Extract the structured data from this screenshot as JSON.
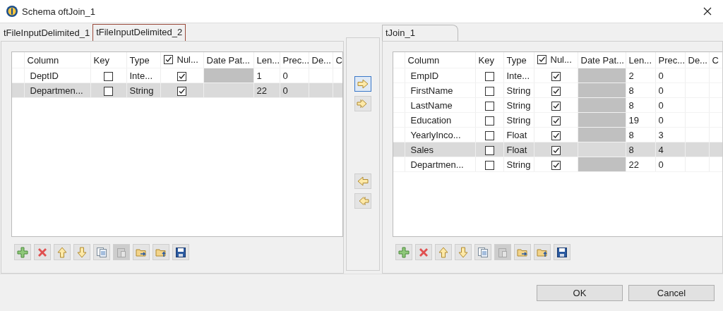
{
  "window": {
    "title": "Schema oftJoin_1"
  },
  "panels": [
    {
      "tabs": [
        {
          "label": "tFileInputDelimited_1",
          "selected": false
        },
        {
          "label": "tFileInputDelimited_2",
          "selected": true
        }
      ],
      "table": {
        "columns": [
          "Column",
          "Key",
          "Type",
          "Nul...",
          "Date Pat...",
          "Len...",
          "Prec...",
          "De...",
          "C"
        ],
        "nullable_header_checked": true,
        "rows": [
          {
            "name": "DeptID",
            "key": false,
            "type": "Inte...",
            "nullable": true,
            "length": "1",
            "precision": "0",
            "selected": false
          },
          {
            "name": "Departmen...",
            "key": false,
            "type": "String",
            "nullable": true,
            "length": "22",
            "precision": "0",
            "selected": true
          }
        ]
      },
      "toolbar": [
        {
          "kind": "add",
          "disabled": false
        },
        {
          "kind": "delete",
          "disabled": false
        },
        {
          "kind": "up",
          "disabled": false
        },
        {
          "kind": "down",
          "disabled": false
        },
        {
          "kind": "copy",
          "disabled": false
        },
        {
          "kind": "paste",
          "disabled": true
        },
        {
          "kind": "import",
          "disabled": false
        },
        {
          "kind": "export",
          "disabled": false
        },
        {
          "kind": "save",
          "disabled": false
        }
      ]
    },
    {
      "tabs": [
        {
          "label": "tJoin_1",
          "selected": false
        }
      ],
      "table": {
        "columns": [
          "Column",
          "Key",
          "Type",
          "Nul...",
          "Date Pat...",
          "Len...",
          "Prec...",
          "De...",
          "C"
        ],
        "nullable_header_checked": true,
        "rows": [
          {
            "name": "EmpID",
            "key": false,
            "type": "Inte...",
            "nullable": true,
            "length": "2",
            "precision": "0",
            "selected": false
          },
          {
            "name": "FirstName",
            "key": false,
            "type": "String",
            "nullable": true,
            "length": "8",
            "precision": "0",
            "selected": false
          },
          {
            "name": "LastName",
            "key": false,
            "type": "String",
            "nullable": true,
            "length": "8",
            "precision": "0",
            "selected": false
          },
          {
            "name": "Education",
            "key": false,
            "type": "String",
            "nullable": true,
            "length": "19",
            "precision": "0",
            "selected": false
          },
          {
            "name": "YearlyInco...",
            "key": false,
            "type": "Float",
            "nullable": true,
            "length": "8",
            "precision": "3",
            "selected": false
          },
          {
            "name": "Sales",
            "key": false,
            "type": "Float",
            "nullable": true,
            "length": "8",
            "precision": "4",
            "selected": true
          },
          {
            "name": "Departmen...",
            "key": false,
            "type": "String",
            "nullable": true,
            "length": "22",
            "precision": "0",
            "selected": false
          }
        ]
      },
      "toolbar": [
        {
          "kind": "add",
          "disabled": false
        },
        {
          "kind": "delete",
          "disabled": false
        },
        {
          "kind": "up",
          "disabled": false
        },
        {
          "kind": "down",
          "disabled": false
        },
        {
          "kind": "copy",
          "disabled": false
        },
        {
          "kind": "paste",
          "disabled": true
        },
        {
          "kind": "import",
          "disabled": false
        },
        {
          "kind": "export",
          "disabled": false
        },
        {
          "kind": "save",
          "disabled": false
        }
      ]
    }
  ],
  "transfer": [
    {
      "kind": "right",
      "focused": true
    },
    {
      "kind": "all-right",
      "focused": false
    },
    {
      "kind": "left",
      "focused": false
    },
    {
      "kind": "all-left",
      "focused": false
    }
  ],
  "buttons": [
    "OK",
    "Cancel"
  ]
}
